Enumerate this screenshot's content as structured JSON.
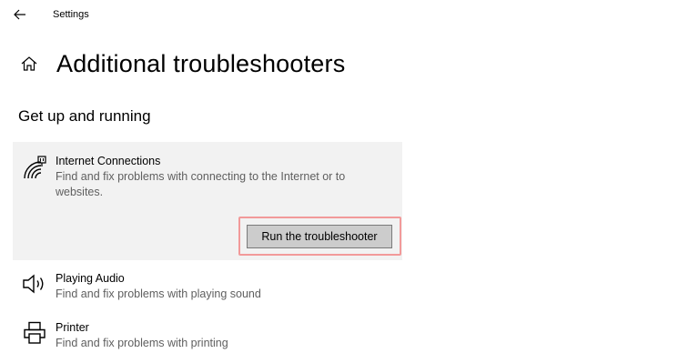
{
  "window": {
    "title": "Settings",
    "back_icon": "back-arrow-icon"
  },
  "header": {
    "icon": "home-icon",
    "title": "Additional troubleshooters"
  },
  "section": {
    "title": "Get up and running"
  },
  "troubleshooters": [
    {
      "icon": "wifi-ethernet-icon",
      "name": "Internet Connections",
      "description": "Find and fix problems with connecting to the Internet or to websites.",
      "expanded": true,
      "action_label": "Run the troubleshooter"
    },
    {
      "icon": "speaker-icon",
      "name": "Playing Audio",
      "description": "Find and fix problems with playing sound"
    },
    {
      "icon": "printer-icon",
      "name": "Printer",
      "description": "Find and fix problems with printing"
    }
  ],
  "colors": {
    "expanded_background": "#f2f2f2",
    "button_background": "#cccccc",
    "highlight_outline": "#f29a9a",
    "description_text": "#5f5f5f"
  }
}
